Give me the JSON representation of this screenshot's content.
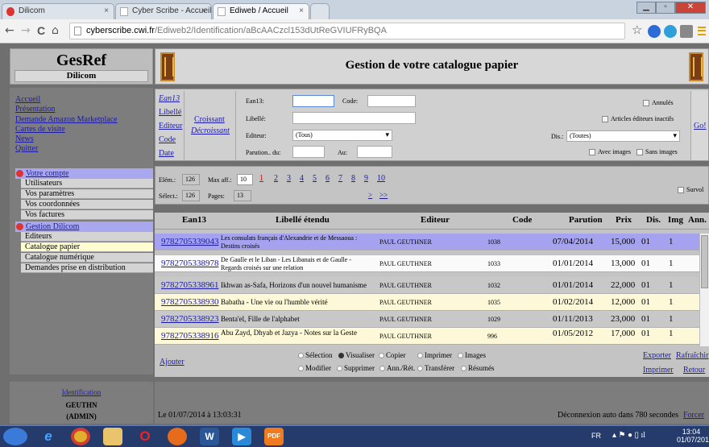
{
  "browser": {
    "tabs": [
      {
        "title": "Dilicom",
        "close": "×"
      },
      {
        "title": "Cyber Scribe - Accueil",
        "close": "×"
      },
      {
        "title": "Ediweb / Accueil",
        "close": "×"
      }
    ],
    "window_buttons": [
      "▁",
      "▫",
      "✕"
    ],
    "url_host": "cyberscribe.cwi.fr",
    "url_path": "/Ediweb2/Identification/aBcAACzcl153dUtReGVIUFRyBQA",
    "nav": {
      "back": "←",
      "forward": "→",
      "reload": "C",
      "home": "⌂"
    },
    "star": "☆"
  },
  "sidebar": {
    "brand": "GesRef",
    "subtitle": "Dilicom",
    "links": [
      "Accueil",
      "Présentation",
      "Demande Amazon Marketplace",
      "Cartes de visite",
      "News",
      "Quitter"
    ],
    "groups": [
      {
        "label": "Votre compte",
        "items": [
          "Utilisateurs",
          "Vos paramètres",
          "Vos coordonnées",
          "Vos factures"
        ]
      },
      {
        "label": "Gestion Dilicom",
        "items": [
          "Editeurs",
          "Catalogue papier",
          "Catalogue numérique",
          "Demandes prise en distribution"
        ]
      }
    ],
    "selected_item": "Catalogue papier",
    "user": {
      "link": "Identification",
      "name": "GEUTHN",
      "role": "(ADMIN)"
    }
  },
  "header": {
    "title": "Gestion de votre catalogue papier"
  },
  "filter": {
    "sort_fields": [
      "Ean13",
      "Libellé",
      "Editeur",
      "Code",
      "Date"
    ],
    "order": [
      "Croissant",
      "Décroissant"
    ],
    "ean_label": "Ean13:",
    "code_label": "Code:",
    "libelle_label": "Libellé:",
    "editeur_label": "Editeur:",
    "editeur_value": "(Tous)",
    "parution_label": "Parution.. du:",
    "au_label": "Au:",
    "annules_label": "Annulés",
    "inactifs_label": "Articles éditeurs inactifs",
    "dis_label": "Dis.:",
    "dis_value": "(Toutes)",
    "avec_images": "Avec images",
    "sans_images": "Sans images",
    "go": "Go!"
  },
  "pager": {
    "elem_label": "Elém.:",
    "elem_value": "126",
    "max_label": "Max aff.:",
    "max_value": "10",
    "select_label": "Sélect.:",
    "select_value": "126",
    "pages_label": "Pages:",
    "pages_value": "13",
    "current_page": "1",
    "pages": [
      "2",
      "3",
      "4",
      "5",
      "6",
      "7",
      "8",
      "9",
      "10"
    ],
    "next": ">",
    "last": ">>",
    "survol": "Survol"
  },
  "table": {
    "headers": [
      "Ean13",
      "Libellé étendu",
      "Editeur",
      "Code",
      "Parution",
      "Prix",
      "Dis.",
      "Img",
      "Ann."
    ],
    "rows": [
      {
        "ean": "9782705339043",
        "libelle": "Les consulats français d'Alexandrie et de Messaoua : Destins croisés",
        "editeur": "PAUL GEUTHNER",
        "code": "1038",
        "parution": "07/04/2014",
        "prix": "15,000",
        "dis": "01",
        "img": "1"
      },
      {
        "ean": "9782705338978",
        "libelle": "De Gaulle et le Liban - Les Libanais et de Gaulle - Regards croisés sur une relation",
        "editeur": "PAUL GEUTHNER",
        "code": "1033",
        "parution": "01/01/2014",
        "prix": "13,000",
        "dis": "01",
        "img": "1"
      },
      {
        "ean": "9782705338961",
        "libelle": "Ikhwan as-Safa, Horizons d'un nouvel humanisme",
        "editeur": "PAUL GEUTHNER",
        "code": "1032",
        "parution": "01/01/2014",
        "prix": "22,000",
        "dis": "01",
        "img": "1"
      },
      {
        "ean": "9782705338930",
        "libelle": "Babatha - Une vie ou l'humble vérité",
        "editeur": "PAUL GEUTHNER",
        "code": "1035",
        "parution": "01/02/2014",
        "prix": "12,000",
        "dis": "01",
        "img": "1"
      },
      {
        "ean": "9782705338923",
        "libelle": "Benta'el, Fille de l'alphabet",
        "editeur": "PAUL GEUTHNER",
        "code": "1029",
        "parution": "01/11/2013",
        "prix": "23,000",
        "dis": "01",
        "img": "1"
      },
      {
        "ean": "9782705338916",
        "libelle": "Abu Zayd, Dhyab et Jazya - Notes sur la Geste",
        "editeur": "PAUL GEUTHNER",
        "code": "996",
        "parution": "01/05/2012",
        "prix": "17,000",
        "dis": "01",
        "img": "1"
      }
    ]
  },
  "actions": {
    "ajouter": "Ajouter",
    "modes": [
      "Sélection",
      "Visualiser",
      "Copier",
      "Imprimer",
      "Images",
      "Modifier",
      "Supprimer",
      "Ann./Rét.",
      "Transférer",
      "Résumés"
    ],
    "selected_mode": "Visualiser",
    "exporter": "Exporter",
    "rafraichir": "Rafraîchir",
    "imprimer": "Imprimer",
    "retour": "Retour"
  },
  "status": {
    "date_text": "Le 01/07/2014 à 13:03:31",
    "timeout_text": "Déconnexion auto dans 780 secondes",
    "force_link": "Forcer"
  },
  "taskbar": {
    "lang": "FR",
    "time": "13:04",
    "date": "01/07/2014"
  },
  "colors": {
    "selected_row": "#a5a3f0",
    "group_header": "#a9a8ee",
    "link": "#1a1aa6",
    "current_page": "#e00000"
  }
}
